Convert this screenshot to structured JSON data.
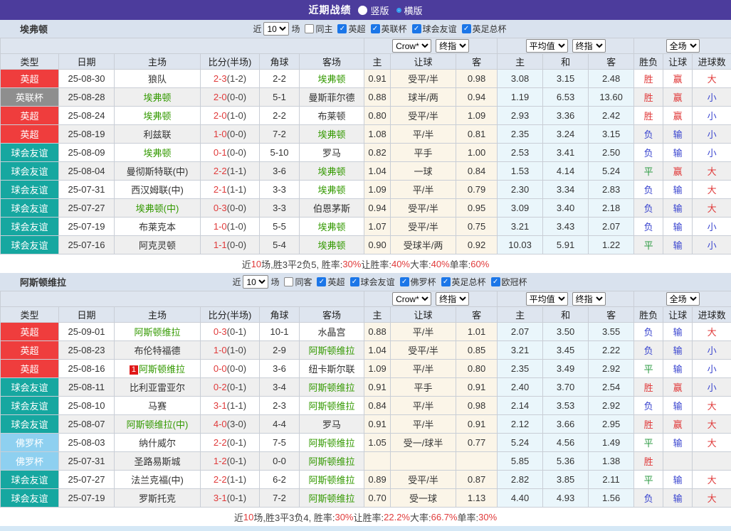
{
  "titlebar": {
    "title": "近期战绩",
    "radios": [
      {
        "label": "竖版",
        "selected": false
      },
      {
        "label": "横版",
        "selected": true
      }
    ]
  },
  "colors": {
    "accent_purple": "#4c3c9c",
    "win_red": "#e03a3a",
    "draw_green": "#2e9b43",
    "lose_blue": "#3a45cf",
    "focus_team_green": "#339900",
    "score_red": "#e03a3a"
  },
  "type_colors": {
    "英超": "#ef3d3d",
    "英联杯": "#8e8e8e",
    "球会友谊": "#16a7a0",
    "佛罗杯": "#8ed0f0"
  },
  "table_header": {
    "cols": [
      "类型",
      "日期",
      "主场",
      "比分(半场)",
      "角球",
      "客场"
    ],
    "sub": [
      "主",
      "让球",
      "客",
      "主",
      "和",
      "客",
      "胜负",
      "让球",
      "进球数"
    ],
    "selects": [
      "Crow*",
      "终指",
      "平均值",
      "终指",
      "全场"
    ]
  },
  "sections": [
    {
      "team": "埃弗顿",
      "filter": {
        "near_label": "近",
        "matches_value": "10",
        "matches_label": "场",
        "same": {
          "label": "同主",
          "checked": false
        },
        "competitions": [
          {
            "label": "英超",
            "checked": true
          },
          {
            "label": "英联杯",
            "checked": true
          },
          {
            "label": "球会友谊",
            "checked": true
          },
          {
            "label": "英足总杯",
            "checked": true
          }
        ]
      },
      "rows": [
        {
          "type": "英超",
          "date": "25-08-30",
          "home": {
            "name": "狼队",
            "focus": false
          },
          "score": {
            "ft": "2-3",
            "ht": "(1-2)"
          },
          "corner": "2-2",
          "away": {
            "name": "埃弗顿",
            "focus": true
          },
          "odds": [
            "0.91",
            "受平/半",
            "0.98"
          ],
          "avg": [
            "3.08",
            "3.15",
            "2.48"
          ],
          "results": [
            [
              "胜",
              "w"
            ],
            [
              "赢",
              "w"
            ],
            [
              "大",
              "w"
            ]
          ]
        },
        {
          "type": "英联杯",
          "date": "25-08-28",
          "home": {
            "name": "埃弗顿",
            "focus": true
          },
          "score": {
            "ft": "2-0",
            "ht": "(0-0)"
          },
          "corner": "5-1",
          "away": {
            "name": "曼斯菲尔德",
            "focus": false
          },
          "odds": [
            "0.88",
            "球半/两",
            "0.94"
          ],
          "avg": [
            "1.19",
            "6.53",
            "13.60"
          ],
          "results": [
            [
              "胜",
              "w"
            ],
            [
              "赢",
              "w"
            ],
            [
              "小",
              "l"
            ]
          ]
        },
        {
          "type": "英超",
          "date": "25-08-24",
          "home": {
            "name": "埃弗顿",
            "focus": true
          },
          "score": {
            "ft": "2-0",
            "ht": "(1-0)"
          },
          "corner": "2-2",
          "away": {
            "name": "布莱顿",
            "focus": false
          },
          "odds": [
            "0.80",
            "受平/半",
            "1.09"
          ],
          "avg": [
            "2.93",
            "3.36",
            "2.42"
          ],
          "results": [
            [
              "胜",
              "w"
            ],
            [
              "赢",
              "w"
            ],
            [
              "小",
              "l"
            ]
          ]
        },
        {
          "type": "英超",
          "date": "25-08-19",
          "home": {
            "name": "利兹联",
            "focus": false
          },
          "score": {
            "ft": "1-0",
            "ht": "(0-0)"
          },
          "corner": "7-2",
          "away": {
            "name": "埃弗顿",
            "focus": true
          },
          "odds": [
            "1.08",
            "平/半",
            "0.81"
          ],
          "avg": [
            "2.35",
            "3.24",
            "3.15"
          ],
          "results": [
            [
              "负",
              "l"
            ],
            [
              "输",
              "l"
            ],
            [
              "小",
              "l"
            ]
          ]
        },
        {
          "type": "球会友谊",
          "date": "25-08-09",
          "home": {
            "name": "埃弗顿",
            "focus": true
          },
          "score": {
            "ft": "0-1",
            "ht": "(0-0)"
          },
          "corner": "5-10",
          "away": {
            "name": "罗马",
            "focus": false
          },
          "odds": [
            "0.82",
            "平手",
            "1.00"
          ],
          "avg": [
            "2.53",
            "3.41",
            "2.50"
          ],
          "results": [
            [
              "负",
              "l"
            ],
            [
              "输",
              "l"
            ],
            [
              "小",
              "l"
            ]
          ]
        },
        {
          "type": "球会友谊",
          "date": "25-08-04",
          "home": {
            "name": "曼彻斯特联(中)",
            "focus": false
          },
          "score": {
            "ft": "2-2",
            "ht": "(1-1)"
          },
          "corner": "3-6",
          "away": {
            "name": "埃弗顿",
            "focus": true
          },
          "odds": [
            "1.04",
            "一球",
            "0.84"
          ],
          "avg": [
            "1.53",
            "4.14",
            "5.24"
          ],
          "results": [
            [
              "平",
              "d"
            ],
            [
              "赢",
              "w"
            ],
            [
              "大",
              "w"
            ]
          ]
        },
        {
          "type": "球会友谊",
          "date": "25-07-31",
          "home": {
            "name": "西汉姆联(中)",
            "focus": false
          },
          "score": {
            "ft": "2-1",
            "ht": "(1-1)"
          },
          "corner": "3-3",
          "away": {
            "name": "埃弗顿",
            "focus": true
          },
          "odds": [
            "1.09",
            "平/半",
            "0.79"
          ],
          "avg": [
            "2.30",
            "3.34",
            "2.83"
          ],
          "results": [
            [
              "负",
              "l"
            ],
            [
              "输",
              "l"
            ],
            [
              "大",
              "w"
            ]
          ]
        },
        {
          "type": "球会友谊",
          "date": "25-07-27",
          "home": {
            "name": "埃弗顿(中)",
            "focus": true
          },
          "score": {
            "ft": "0-3",
            "ht": "(0-0)"
          },
          "corner": "3-3",
          "away": {
            "name": "伯恩茅斯",
            "focus": false
          },
          "odds": [
            "0.94",
            "受平/半",
            "0.95"
          ],
          "avg": [
            "3.09",
            "3.40",
            "2.18"
          ],
          "results": [
            [
              "负",
              "l"
            ],
            [
              "输",
              "l"
            ],
            [
              "大",
              "w"
            ]
          ]
        },
        {
          "type": "球会友谊",
          "date": "25-07-19",
          "home": {
            "name": "布莱克本",
            "focus": false
          },
          "score": {
            "ft": "1-0",
            "ht": "(1-0)"
          },
          "corner": "5-5",
          "away": {
            "name": "埃弗顿",
            "focus": true
          },
          "odds": [
            "1.07",
            "受平/半",
            "0.75"
          ],
          "avg": [
            "3.21",
            "3.43",
            "2.07"
          ],
          "results": [
            [
              "负",
              "l"
            ],
            [
              "输",
              "l"
            ],
            [
              "小",
              "l"
            ]
          ]
        },
        {
          "type": "球会友谊",
          "date": "25-07-16",
          "home": {
            "name": "阿克灵顿",
            "focus": false
          },
          "score": {
            "ft": "1-1",
            "ht": "(0-0)"
          },
          "corner": "5-4",
          "away": {
            "name": "埃弗顿",
            "focus": true
          },
          "odds": [
            "0.90",
            "受球半/两",
            "0.92"
          ],
          "avg": [
            "10.03",
            "5.91",
            "1.22"
          ],
          "results": [
            [
              "平",
              "d"
            ],
            [
              "输",
              "l"
            ],
            [
              "小",
              "l"
            ]
          ]
        }
      ],
      "summary": [
        [
          "近",
          false
        ],
        [
          "10",
          true
        ],
        [
          "场,胜3平2负5, 胜率:",
          false
        ],
        [
          "30%",
          true
        ],
        [
          " 让胜率:",
          false
        ],
        [
          "40%",
          true
        ],
        [
          " 大率:",
          false
        ],
        [
          "40%",
          true
        ],
        [
          " 单率:",
          false
        ],
        [
          "60%",
          true
        ]
      ]
    },
    {
      "team": "阿斯顿维拉",
      "filter": {
        "near_label": "近",
        "matches_value": "10",
        "matches_label": "场",
        "same": {
          "label": "同客",
          "checked": false
        },
        "competitions": [
          {
            "label": "英超",
            "checked": true
          },
          {
            "label": "球会友谊",
            "checked": true
          },
          {
            "label": "佛罗杯",
            "checked": true
          },
          {
            "label": "英足总杯",
            "checked": true
          },
          {
            "label": "欧冠杯",
            "checked": true
          }
        ]
      },
      "rows": [
        {
          "type": "英超",
          "date": "25-09-01",
          "home": {
            "name": "阿斯顿维拉",
            "focus": true
          },
          "score": {
            "ft": "0-3",
            "ht": "(0-1)"
          },
          "corner": "10-1",
          "away": {
            "name": "水晶宫",
            "focus": false
          },
          "odds": [
            "0.88",
            "平/半",
            "1.01"
          ],
          "avg": [
            "2.07",
            "3.50",
            "3.55"
          ],
          "results": [
            [
              "负",
              "l"
            ],
            [
              "输",
              "l"
            ],
            [
              "大",
              "w"
            ]
          ]
        },
        {
          "type": "英超",
          "date": "25-08-23",
          "home": {
            "name": "布伦特福德",
            "focus": false
          },
          "score": {
            "ft": "1-0",
            "ht": "(1-0)"
          },
          "corner": "2-9",
          "away": {
            "name": "阿斯顿维拉",
            "focus": true
          },
          "odds": [
            "1.04",
            "受平/半",
            "0.85"
          ],
          "avg": [
            "3.21",
            "3.45",
            "2.22"
          ],
          "results": [
            [
              "负",
              "l"
            ],
            [
              "输",
              "l"
            ],
            [
              "小",
              "l"
            ]
          ]
        },
        {
          "type": "英超",
          "date": "25-08-16",
          "home": {
            "name": "阿斯顿维拉",
            "focus": true,
            "badge": "1"
          },
          "score": {
            "ft": "0-0",
            "ht": "(0-0)"
          },
          "corner": "3-6",
          "away": {
            "name": "纽卡斯尔联",
            "focus": false
          },
          "odds": [
            "1.09",
            "平/半",
            "0.80"
          ],
          "avg": [
            "2.35",
            "3.49",
            "2.92"
          ],
          "results": [
            [
              "平",
              "d"
            ],
            [
              "输",
              "l"
            ],
            [
              "小",
              "l"
            ]
          ]
        },
        {
          "type": "球会友谊",
          "date": "25-08-11",
          "home": {
            "name": "比利亚雷亚尔",
            "focus": false
          },
          "score": {
            "ft": "0-2",
            "ht": "(0-1)"
          },
          "corner": "3-4",
          "away": {
            "name": "阿斯顿维拉",
            "focus": true
          },
          "odds": [
            "0.91",
            "平手",
            "0.91"
          ],
          "avg": [
            "2.40",
            "3.70",
            "2.54"
          ],
          "results": [
            [
              "胜",
              "w"
            ],
            [
              "赢",
              "w"
            ],
            [
              "小",
              "l"
            ]
          ]
        },
        {
          "type": "球会友谊",
          "date": "25-08-10",
          "home": {
            "name": "马赛",
            "focus": false
          },
          "score": {
            "ft": "3-1",
            "ht": "(1-1)"
          },
          "corner": "2-3",
          "away": {
            "name": "阿斯顿维拉",
            "focus": true
          },
          "odds": [
            "0.84",
            "平/半",
            "0.98"
          ],
          "avg": [
            "2.14",
            "3.53",
            "2.92"
          ],
          "results": [
            [
              "负",
              "l"
            ],
            [
              "输",
              "l"
            ],
            [
              "大",
              "w"
            ]
          ]
        },
        {
          "type": "球会友谊",
          "date": "25-08-07",
          "home": {
            "name": "阿斯顿维拉(中)",
            "focus": true
          },
          "score": {
            "ft": "4-0",
            "ht": "(3-0)"
          },
          "corner": "4-4",
          "away": {
            "name": "罗马",
            "focus": false
          },
          "odds": [
            "0.91",
            "平/半",
            "0.91"
          ],
          "avg": [
            "2.12",
            "3.66",
            "2.95"
          ],
          "results": [
            [
              "胜",
              "w"
            ],
            [
              "赢",
              "w"
            ],
            [
              "大",
              "w"
            ]
          ]
        },
        {
          "type": "佛罗杯",
          "date": "25-08-03",
          "home": {
            "name": "纳什威尔",
            "focus": false
          },
          "score": {
            "ft": "2-2",
            "ht": "(0-1)"
          },
          "corner": "7-5",
          "away": {
            "name": "阿斯顿维拉",
            "focus": true
          },
          "odds": [
            "1.05",
            "受一/球半",
            "0.77"
          ],
          "avg": [
            "5.24",
            "4.56",
            "1.49"
          ],
          "results": [
            [
              "平",
              "d"
            ],
            [
              "输",
              "l"
            ],
            [
              "大",
              "w"
            ]
          ]
        },
        {
          "type": "佛罗杯",
          "date": "25-07-31",
          "home": {
            "name": "圣路易斯城",
            "focus": false
          },
          "score": {
            "ft": "1-2",
            "ht": "(0-1)"
          },
          "corner": "0-0",
          "away": {
            "name": "阿斯顿维拉",
            "focus": true
          },
          "odds": [
            "",
            "",
            ""
          ],
          "avg": [
            "5.85",
            "5.36",
            "1.38"
          ],
          "results": [
            [
              "胜",
              "w"
            ],
            [
              "",
              "l"
            ],
            [
              "",
              "l"
            ]
          ]
        },
        {
          "type": "球会友谊",
          "date": "25-07-27",
          "home": {
            "name": "法兰克福(中)",
            "focus": false
          },
          "score": {
            "ft": "2-2",
            "ht": "(1-1)"
          },
          "corner": "6-2",
          "away": {
            "name": "阿斯顿维拉",
            "focus": true
          },
          "odds": [
            "0.89",
            "受平/半",
            "0.87"
          ],
          "avg": [
            "2.82",
            "3.85",
            "2.11"
          ],
          "results": [
            [
              "平",
              "d"
            ],
            [
              "输",
              "l"
            ],
            [
              "大",
              "w"
            ]
          ]
        },
        {
          "type": "球会友谊",
          "date": "25-07-19",
          "home": {
            "name": "罗斯托克",
            "focus": false
          },
          "score": {
            "ft": "3-1",
            "ht": "(0-1)"
          },
          "corner": "7-2",
          "away": {
            "name": "阿斯顿维拉",
            "focus": true
          },
          "odds": [
            "0.70",
            "受一球",
            "1.13"
          ],
          "avg": [
            "4.40",
            "4.93",
            "1.56"
          ],
          "results": [
            [
              "负",
              "l"
            ],
            [
              "输",
              "l"
            ],
            [
              "大",
              "w"
            ]
          ]
        }
      ],
      "summary": [
        [
          "近",
          false
        ],
        [
          "10",
          true
        ],
        [
          "场,胜3平3负4, 胜率:",
          false
        ],
        [
          "30%",
          true
        ],
        [
          " 让胜率:",
          false
        ],
        [
          "22.2%",
          true
        ],
        [
          " 大率:",
          false
        ],
        [
          "66.7%",
          true
        ],
        [
          " 单率:",
          false
        ],
        [
          "30%",
          true
        ]
      ]
    }
  ]
}
